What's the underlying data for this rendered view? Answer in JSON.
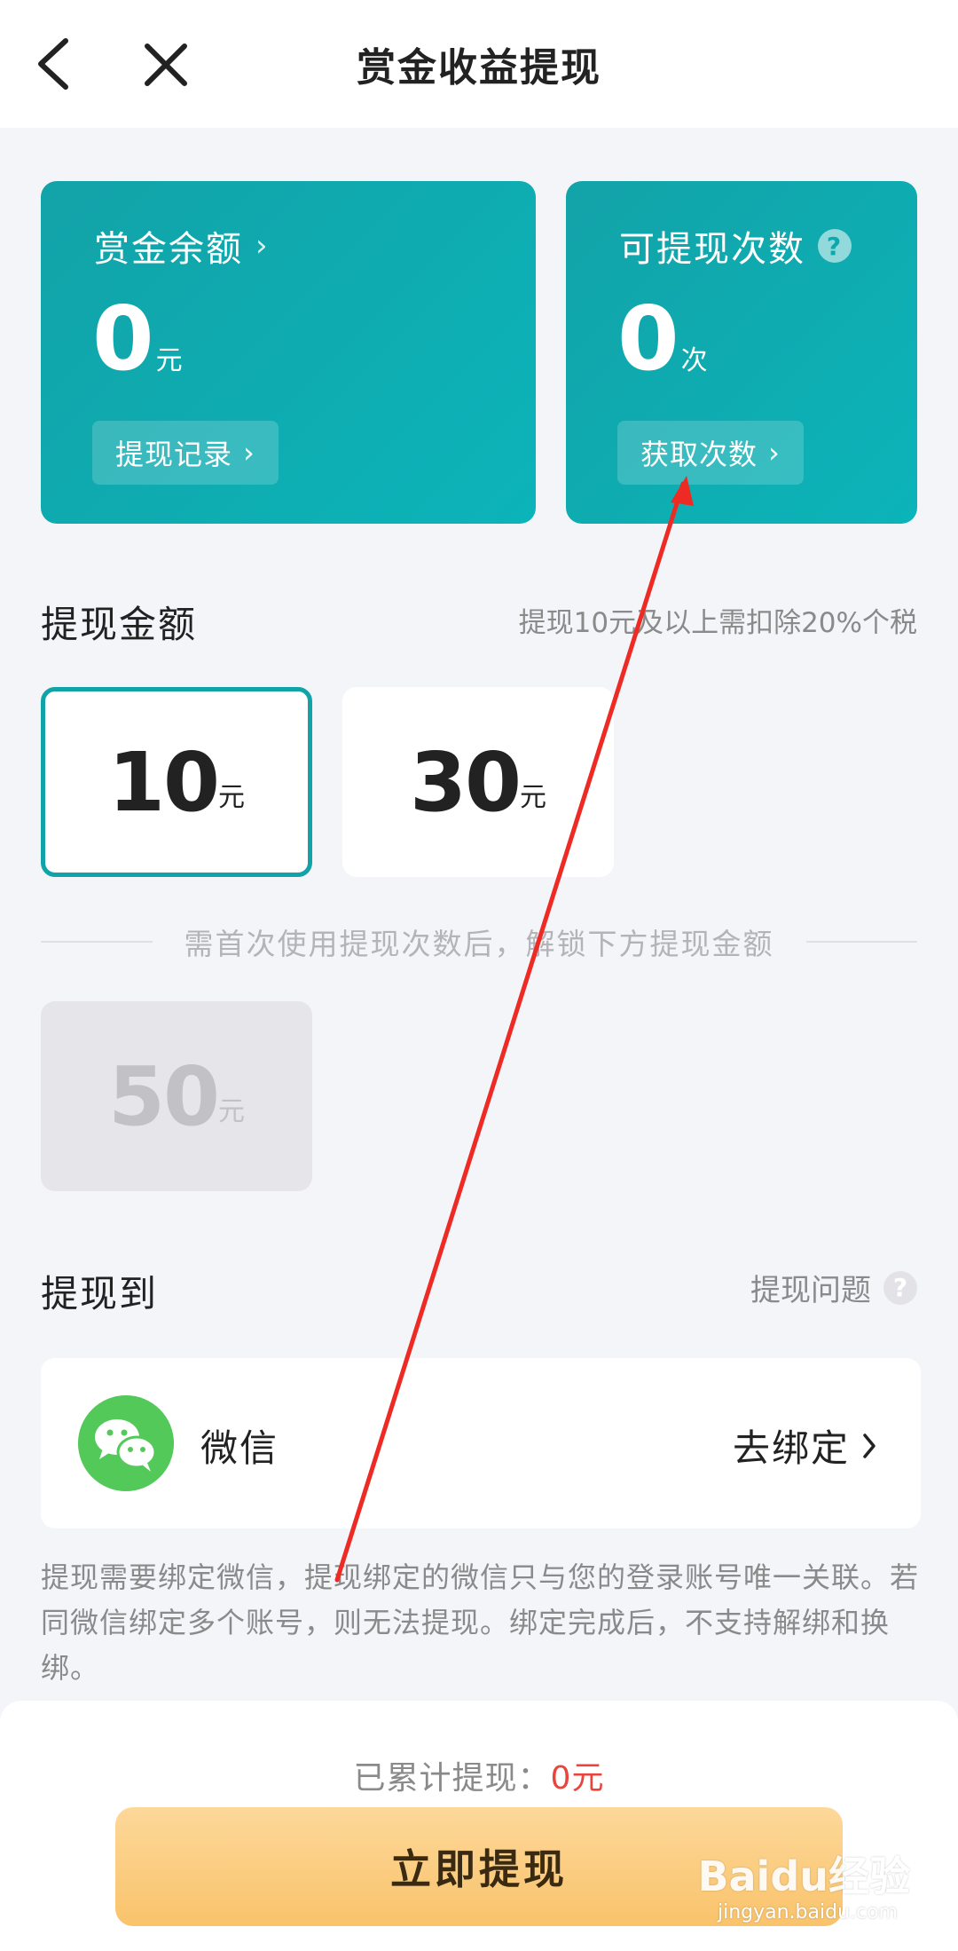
{
  "header": {
    "title": "赏金收益提现"
  },
  "balance_card": {
    "title": "赏金余额",
    "amount": "0",
    "unit": "元",
    "chip_label": "提现记录"
  },
  "count_card": {
    "title": "可提现次数",
    "help_mark": "?",
    "amount": "0",
    "unit": "次",
    "chip_label": "获取次数"
  },
  "withdraw_amount": {
    "title": "提现金额",
    "note": "提现10元及以上需扣除20%个税",
    "options": [
      {
        "value": "10",
        "unit": "元",
        "state": "selected"
      },
      {
        "value": "30",
        "unit": "元",
        "state": "normal"
      }
    ],
    "unlock_text": "需首次使用提现次数后，解锁下方提现金额",
    "locked_option": {
      "value": "50",
      "unit": "元",
      "state": "disabled"
    }
  },
  "withdraw_to": {
    "title": "提现到",
    "help_label": "提现问题",
    "help_mark": "?",
    "method_name": "微信",
    "method_action": "去绑定",
    "method_icon": "wechat-icon"
  },
  "notice": "提现需要绑定微信，提现绑定的微信只与您的登录账号唯一关联。若同微信绑定多个账号，则无法提现。绑定完成后，不支持解绑和换绑。",
  "footer": {
    "total_label": "已累计提现：",
    "total_value": "0元",
    "cta_label": "立即提现"
  },
  "watermark": {
    "brand": "Baidu经验",
    "url": "jingyan.baidu.com"
  },
  "colors": {
    "teal": "#12a3a8",
    "cta": "#f9c36b",
    "red": "#e8453c",
    "wechat": "#53c95a"
  }
}
